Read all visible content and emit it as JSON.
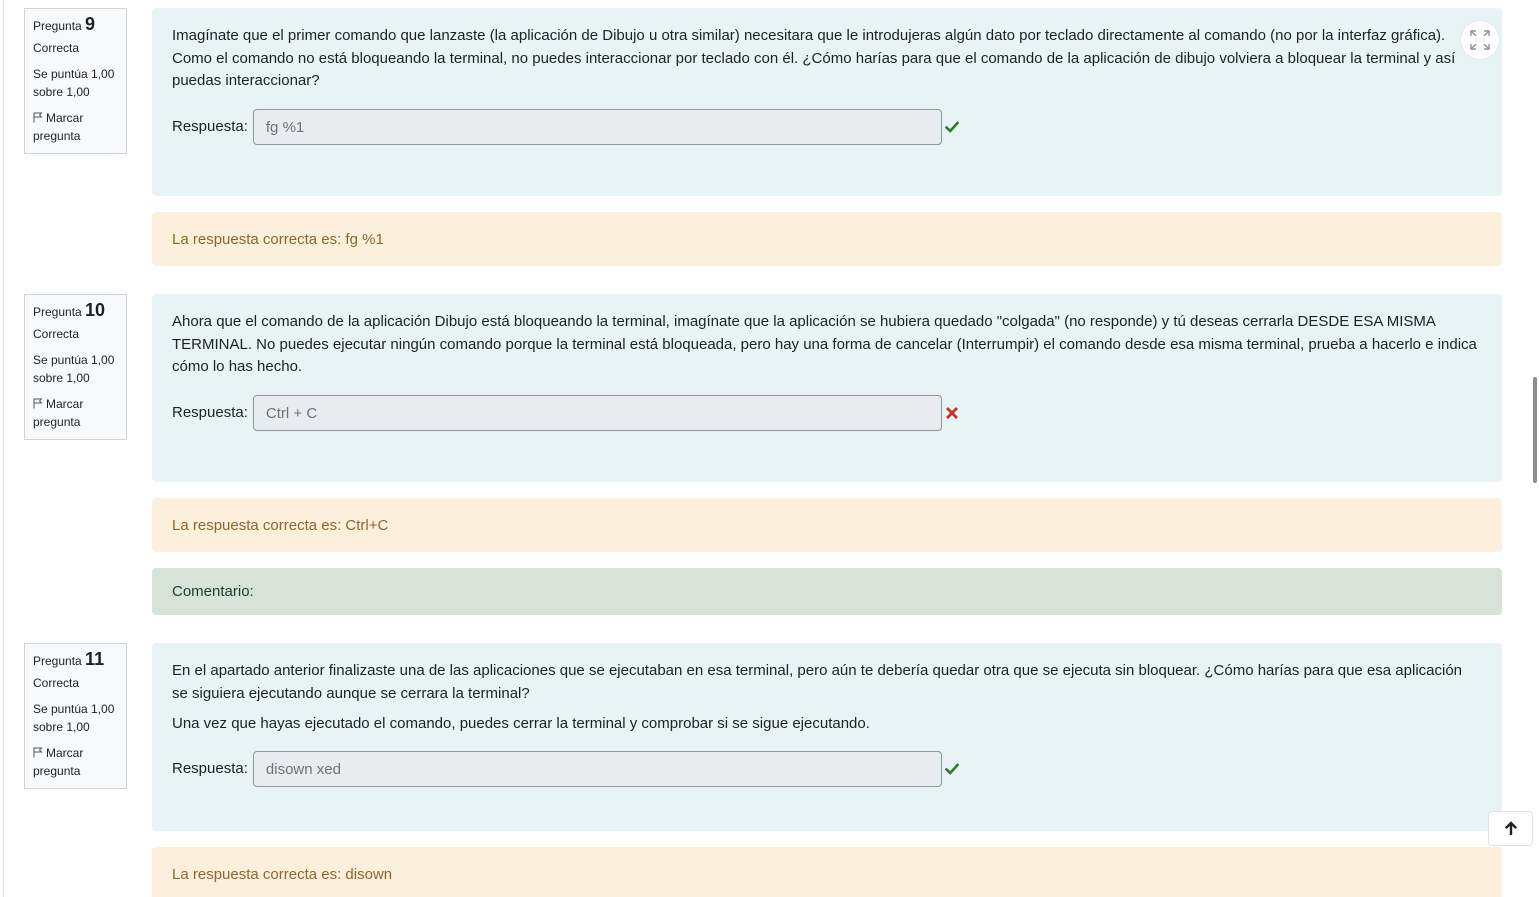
{
  "questions": [
    {
      "label": "Pregunta",
      "number": "9",
      "state": "Correcta",
      "grade": "Se puntúa 1,00 sobre 1,00",
      "flag_label": "Marcar pregunta",
      "text": [
        "Imagínate que el primer comando que lanzaste (la aplicación de Dibujo u otra similar) necesitara que le introdujeras algún dato por teclado directamente al comando (no por la interfaz gráfica). Como el comando no está bloqueando la terminal, no puedes interaccionar por teclado con él. ¿Cómo harías para que el comando de la aplicación de dibujo volviera a bloquear la terminal y así puedas interaccionar?"
      ],
      "answer_label": "Respuesta:",
      "answer_value": "fg %1",
      "result": "correct",
      "right_answer": "La respuesta correcta es: fg %1"
    },
    {
      "label": "Pregunta",
      "number": "10",
      "state": "Correcta",
      "grade": "Se puntúa 1,00 sobre 1,00",
      "flag_label": "Marcar pregunta",
      "text": [
        "Ahora que el comando de la aplicación Dibujo está bloqueando la terminal, imagínate que la aplicación se hubiera quedado \"colgada\" (no responde) y tú deseas cerrarla DESDE ESA MISMA TERMINAL. No puedes ejecutar ningún comando porque la terminal está bloqueada, pero hay una forma de cancelar (Interrumpir) el comando desde esa misma terminal, prueba a hacerlo e indica cómo lo has hecho."
      ],
      "answer_label": "Respuesta:",
      "answer_value": "Ctrl + C",
      "result": "incorrect",
      "right_answer": "La respuesta correcta es: Ctrl+C",
      "comment": "Comentario:"
    },
    {
      "label": "Pregunta",
      "number": "11",
      "state": "Correcta",
      "grade": "Se puntúa 1,00 sobre 1,00",
      "flag_label": "Marcar pregunta",
      "text": [
        "En el apartado anterior finalizaste una de las aplicaciones que se ejecutaban en esa terminal, pero aún te debería quedar otra que se ejecuta sin bloquear. ¿Cómo harías para que esa aplicación se siguiera ejecutando aunque se cerrara la terminal?",
        "Una vez que hayas ejecutado el comando, puedes cerrar la terminal y comprobar si se sigue ejecutando."
      ],
      "answer_label": "Respuesta:",
      "answer_value": "disown xed",
      "result": "correct",
      "right_answer": "La respuesta correcta es: disown"
    }
  ],
  "icons": {
    "expand": "expand-icon",
    "back_to_top": "arrow-up-icon",
    "flag": "flag-icon",
    "correct": "check-icon",
    "incorrect": "cross-icon"
  },
  "colors": {
    "formulation_bg": "#e7f3f5",
    "right_answer_bg": "#fcefdc",
    "right_answer_text": "#8e662e",
    "comment_bg": "#d7e3d9",
    "correct": "#357a32",
    "incorrect": "#ca3120"
  }
}
